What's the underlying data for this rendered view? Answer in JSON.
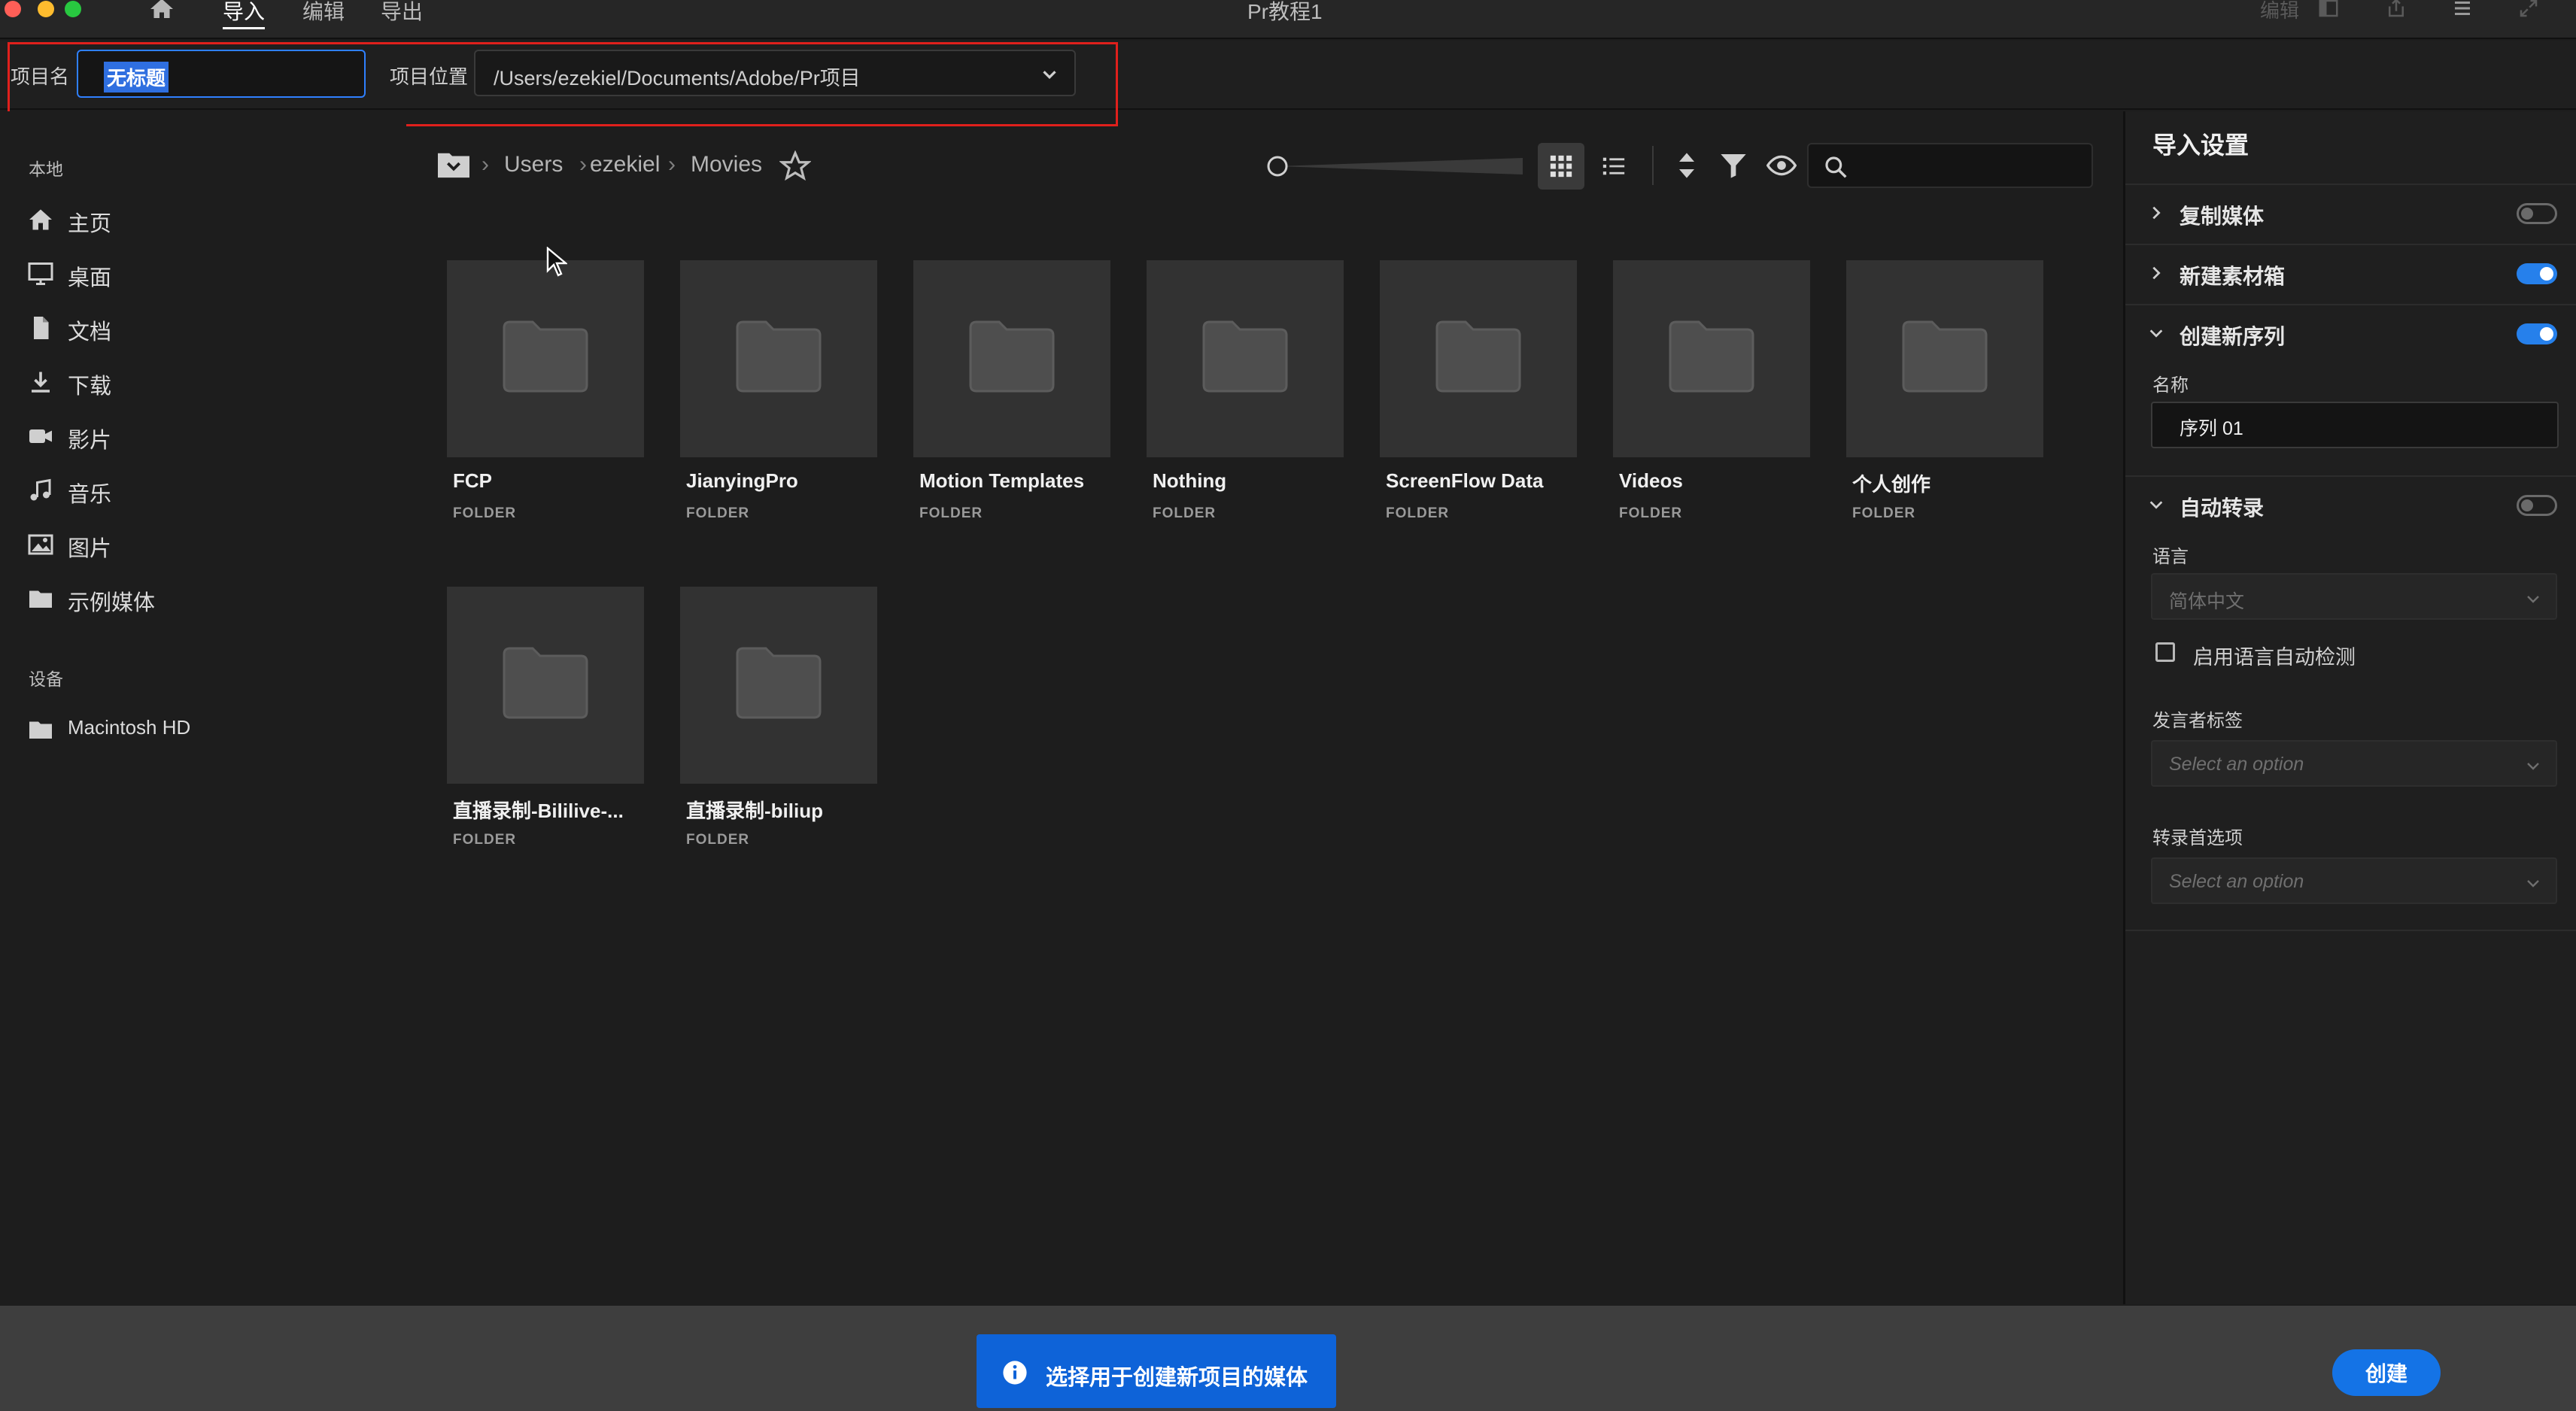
{
  "titlebar": {
    "tabs": [
      {
        "label": "导入",
        "active": true
      },
      {
        "label": "编辑",
        "active": false
      },
      {
        "label": "导出",
        "active": false
      }
    ],
    "app_title": "Pr教程1",
    "right_label": "编辑"
  },
  "project": {
    "name_label": "项目名",
    "name_value": "无标题",
    "location_label": "项目位置",
    "location_value": "/Users/ezekiel/Documents/Adobe/Pr项目"
  },
  "sidebar": {
    "local_heading": "本地",
    "items": [
      {
        "label": "主页",
        "icon": "home-icon"
      },
      {
        "label": "桌面",
        "icon": "monitor-icon"
      },
      {
        "label": "文档",
        "icon": "document-icon"
      },
      {
        "label": "下载",
        "icon": "download-icon"
      },
      {
        "label": "影片",
        "icon": "video-camera-icon"
      },
      {
        "label": "音乐",
        "icon": "music-note-icon"
      },
      {
        "label": "图片",
        "icon": "image-icon"
      },
      {
        "label": "示例媒体",
        "icon": "folder-icon"
      }
    ],
    "devices_heading": "设备",
    "devices": [
      {
        "label": "Macintosh HD",
        "icon": "folder-icon"
      }
    ]
  },
  "breadcrumb": {
    "parts": [
      "Users",
      "ezekiel",
      "Movies"
    ]
  },
  "browser": {
    "folders": [
      {
        "name": "FCP",
        "kind": "FOLDER"
      },
      {
        "name": "JianyingPro",
        "kind": "FOLDER"
      },
      {
        "name": "Motion Templates",
        "kind": "FOLDER"
      },
      {
        "name": "Nothing",
        "kind": "FOLDER"
      },
      {
        "name": "ScreenFlow Data",
        "kind": "FOLDER"
      },
      {
        "name": "Videos",
        "kind": "FOLDER"
      },
      {
        "name": "个人创作",
        "kind": "FOLDER"
      },
      {
        "name": "直播录制-Bililive-...",
        "kind": "FOLDER"
      },
      {
        "name": "直播录制-biliup",
        "kind": "FOLDER"
      }
    ]
  },
  "import_settings": {
    "title": "导入设置",
    "copy_media": {
      "label": "复制媒体",
      "enabled": false
    },
    "new_bin": {
      "label": "新建素材箱",
      "enabled": true
    },
    "new_sequence": {
      "label": "创建新序列",
      "enabled": true,
      "name_label": "名称",
      "name_value": "序列 01"
    },
    "auto_transcribe": {
      "label": "自动转录",
      "enabled": false,
      "language_label": "语言",
      "language_value": "简体中文",
      "auto_detect_label": "启用语言自动检测",
      "speaker_label": "发言者标签",
      "speaker_placeholder": "Select an option",
      "pref_label": "转录首选项",
      "pref_placeholder": "Select an option"
    }
  },
  "footer": {
    "toast": "选择用于创建新项目的媒体",
    "create_label": "创建"
  },
  "colors": {
    "accent": "#1473e6",
    "toast": "#0e63d8",
    "highlight_outline": "#e0201c"
  }
}
